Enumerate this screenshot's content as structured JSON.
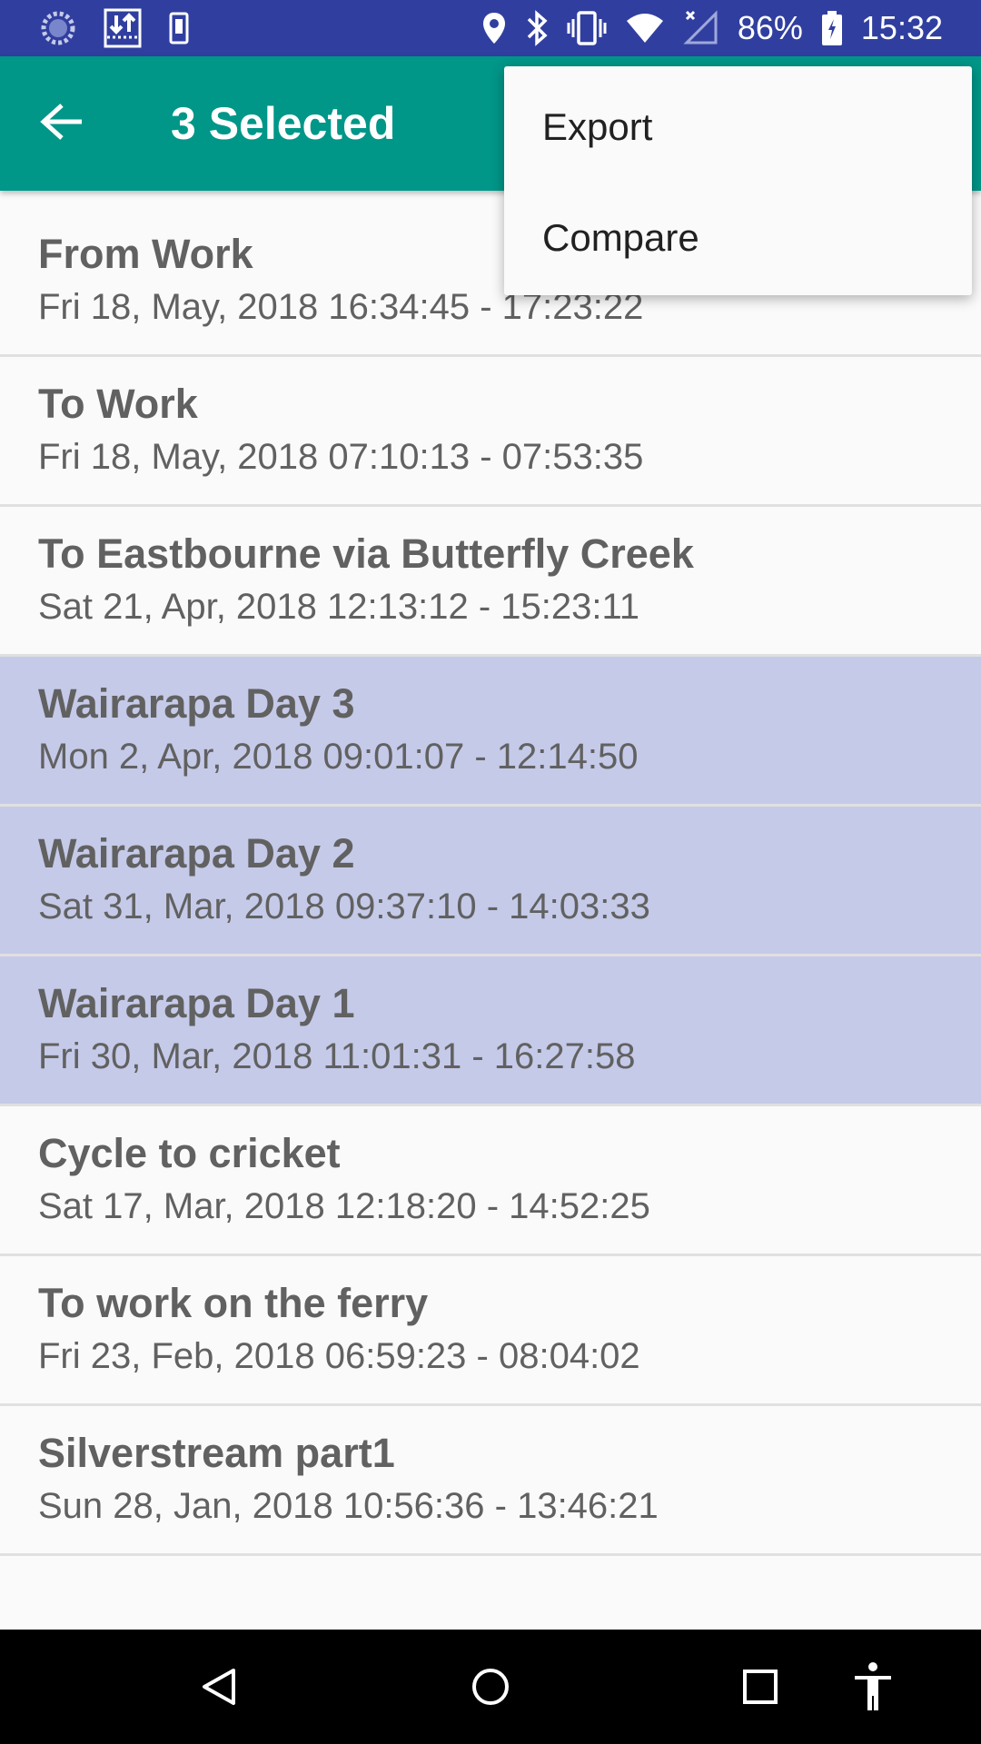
{
  "status_bar": {
    "battery_percent": "86%",
    "time": "15:32",
    "icons_left": [
      "loading-icon",
      "download-icon",
      "sim-icon"
    ],
    "icons_right": [
      "location-icon",
      "bluetooth-icon",
      "vibrate-icon",
      "wifi-icon",
      "signal-icon",
      "battery-icon"
    ]
  },
  "app_bar": {
    "title": "3 Selected",
    "back_icon": "arrow-back-icon"
  },
  "menu": {
    "items": [
      {
        "label": "Export"
      },
      {
        "label": "Compare"
      }
    ]
  },
  "trips": [
    {
      "title": "From Work",
      "subtitle": "Fri 18, May, 2018 16:34:45 - 17:23:22",
      "selected": false
    },
    {
      "title": "To Work",
      "subtitle": "Fri 18, May, 2018 07:10:13 - 07:53:35",
      "selected": false
    },
    {
      "title": "To Eastbourne via Butterfly Creek",
      "subtitle": "Sat 21, Apr, 2018 12:13:12 - 15:23:11",
      "selected": false
    },
    {
      "title": "Wairarapa Day 3",
      "subtitle": "Mon 2, Apr, 2018 09:01:07 - 12:14:50",
      "selected": true
    },
    {
      "title": "Wairarapa Day 2",
      "subtitle": "Sat 31, Mar, 2018 09:37:10 - 14:03:33",
      "selected": true
    },
    {
      "title": "Wairarapa Day 1",
      "subtitle": "Fri 30, Mar, 2018 11:01:31 - 16:27:58",
      "selected": true
    },
    {
      "title": "Cycle to cricket",
      "subtitle": "Sat 17, Mar, 2018 12:18:20 - 14:52:25",
      "selected": false
    },
    {
      "title": "To work on the ferry",
      "subtitle": "Fri 23, Feb, 2018 06:59:23 - 08:04:02",
      "selected": false
    },
    {
      "title": "Silverstream part1",
      "subtitle": "Sun 28, Jan, 2018 10:56:36 - 13:46:21",
      "selected": false
    }
  ],
  "nav_bar": {
    "buttons": [
      "back-nav-icon",
      "home-nav-icon",
      "recents-nav-icon",
      "accessibility-icon"
    ]
  },
  "colors": {
    "status_bar": "#303f9f",
    "app_bar": "#009688",
    "selected_row": "#c5cae9",
    "text": "#616161"
  }
}
